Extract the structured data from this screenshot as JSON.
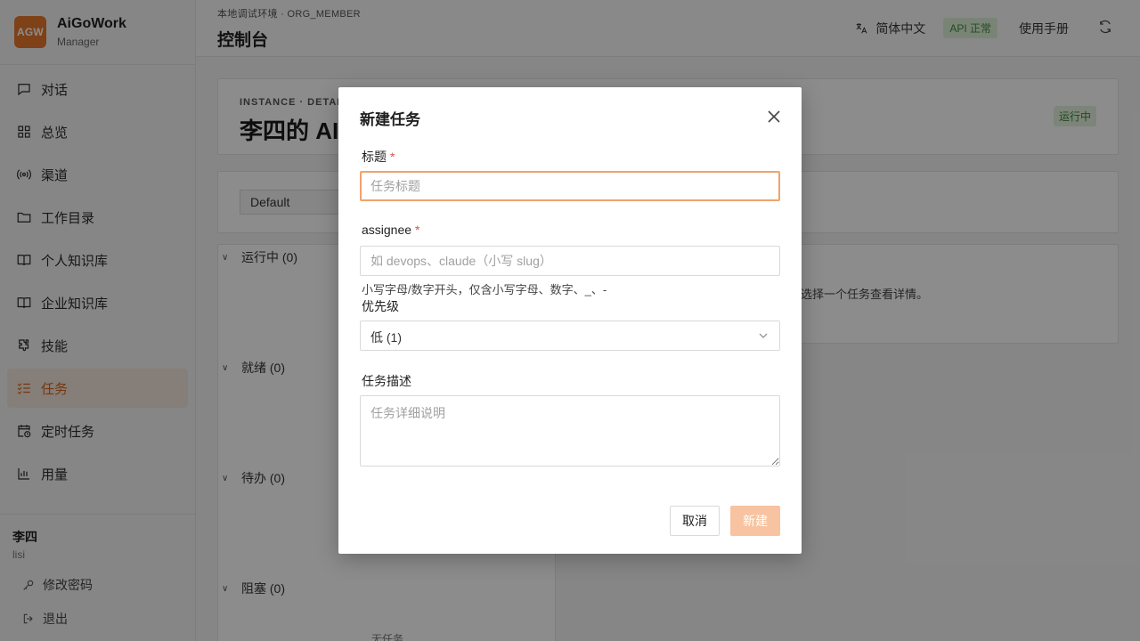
{
  "brand": {
    "logo": "AGW",
    "name": "AiGoWork",
    "sub": "Manager"
  },
  "nav": [
    {
      "label": "对话",
      "icon": "chat-icon",
      "active": false
    },
    {
      "label": "总览",
      "icon": "grid-icon",
      "active": false
    },
    {
      "label": "渠道",
      "icon": "broadcast-icon",
      "active": false
    },
    {
      "label": "工作目录",
      "icon": "folder-icon",
      "active": false
    },
    {
      "label": "个人知识库",
      "icon": "book-icon",
      "active": false
    },
    {
      "label": "企业知识库",
      "icon": "book-icon",
      "active": false
    },
    {
      "label": "技能",
      "icon": "puzzle-icon",
      "active": false
    },
    {
      "label": "任务",
      "icon": "checklist-icon",
      "active": true
    },
    {
      "label": "定时任务",
      "icon": "calendar-clock-icon",
      "active": false
    },
    {
      "label": "用量",
      "icon": "bar-chart-icon",
      "active": false
    }
  ],
  "user": {
    "name": "李四",
    "id": "lisi",
    "change_password": "修改密码",
    "logout": "退出"
  },
  "header": {
    "crumb": "本地调试环境 · ORG_MEMBER",
    "title": "控制台",
    "lang": "简体中文",
    "api_status": "API 正常",
    "manual": "使用手册"
  },
  "instance": {
    "label": "INSTANCE · DETAIL",
    "title": "李四的 AI",
    "status": "运行中"
  },
  "board": {
    "select_value": "Default",
    "sections": [
      {
        "label": "运行中 (0)"
      },
      {
        "label": "就绪 (0)"
      },
      {
        "label": "待办 (0)"
      },
      {
        "label": "阻塞 (0)"
      }
    ],
    "empty": "无任务",
    "detail_hint": "选择一个任务查看详情。"
  },
  "modal": {
    "title": "新建任务",
    "title_field": {
      "label": "标题",
      "placeholder": "任务标题",
      "value": ""
    },
    "assignee_field": {
      "label": "assignee",
      "placeholder": "如 devops、claude（小写 slug）",
      "hint": "小写字母/数字开头，仅含小写字母、数字、_、-",
      "value": ""
    },
    "priority_field": {
      "label": "优先级",
      "value": "低 (1)"
    },
    "desc_field": {
      "label": "任务描述",
      "placeholder": "任务详细说明",
      "value": ""
    },
    "cancel": "取消",
    "create": "新建"
  },
  "colors": {
    "accent": "#e5772c",
    "active_bg": "#f5e6da",
    "success": "#3b8a3b",
    "required": "#e04f3a"
  }
}
